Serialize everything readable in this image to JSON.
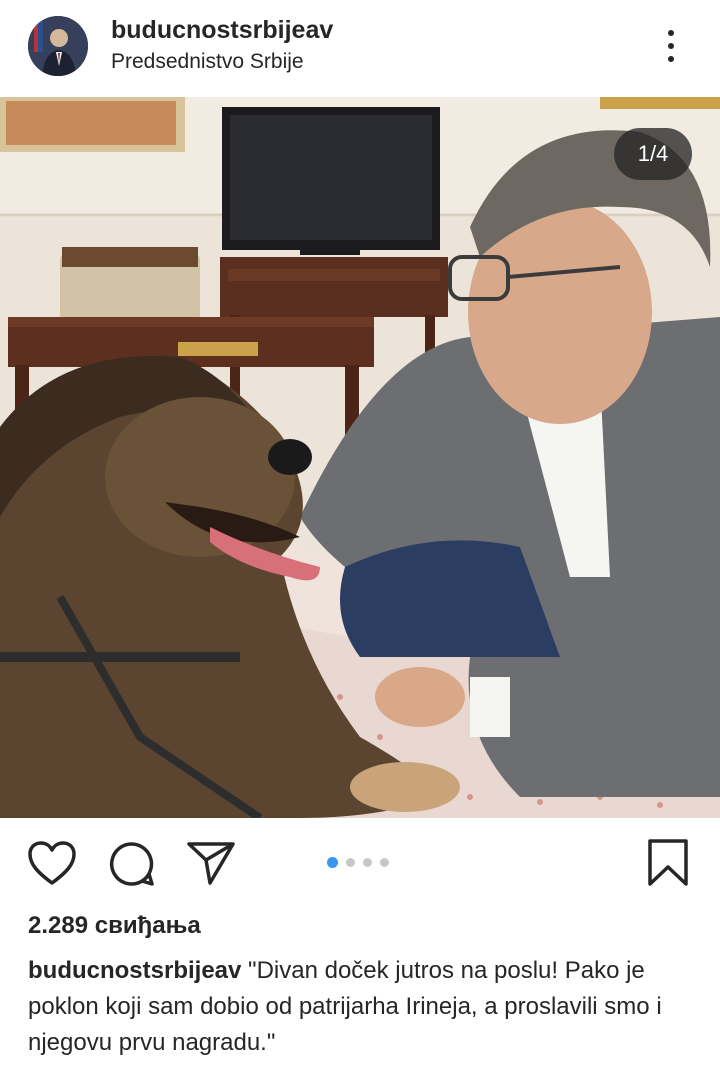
{
  "post": {
    "username": "buducnostsrbijeav",
    "location": "Predsednistvo Srbije",
    "carousel_counter": "1/4",
    "carousel_total": 4,
    "carousel_active_index": 0,
    "likes": "2.289 свиђања",
    "caption_user": "buducnostsrbijeav",
    "caption_text": " \"Divan doček jutros na poslu! Pako je poklon koji sam dobio od patrijarha Irineja, a proslavili smo i njegovu prvu nagradu.\""
  },
  "icons": {
    "more": "more-vertical-icon",
    "like": "heart-icon",
    "comment": "comment-bubble-icon",
    "share": "paper-plane-icon",
    "save": "bookmark-icon"
  },
  "colors": {
    "text": "#262626",
    "carousel_active": "#3897f0",
    "carousel_inactive": "#c7c7c7",
    "counter_bg": "#262626"
  }
}
